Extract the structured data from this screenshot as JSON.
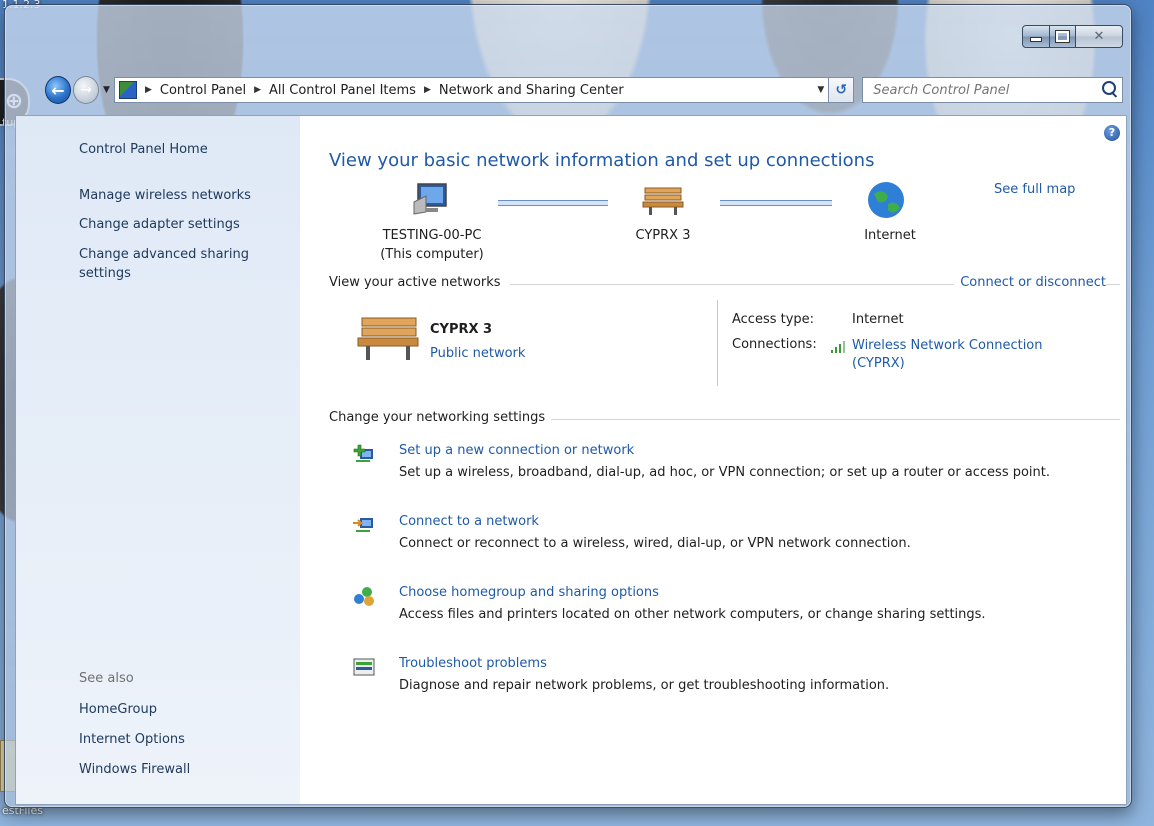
{
  "desktop": {
    "top_left_fragment": "1.1.2.3",
    "left_fragment": "tup",
    "bottom_left_fragment": "estFiles"
  },
  "window": {
    "caption": {
      "minimize": "",
      "maximize": "",
      "close": "✕"
    }
  },
  "navbar": {
    "breadcrumbs": [
      "Control Panel",
      "All Control Panel Items",
      "Network and Sharing Center"
    ],
    "search_placeholder": "Search Control Panel"
  },
  "sidebar": {
    "home": "Control Panel Home",
    "links": [
      "Manage wireless networks",
      "Change adapter settings",
      "Change advanced sharing settings"
    ],
    "see_also_label": "See also",
    "see_also_links": [
      "HomeGroup",
      "Internet Options",
      "Windows Firewall"
    ]
  },
  "main": {
    "title": "View your basic network information and set up connections",
    "see_full_map": "See full map",
    "map": {
      "computer_name": "TESTING-00-PC",
      "computer_sub": "(This computer)",
      "network_name": "CYPRX  3",
      "internet": "Internet"
    },
    "active_networks": {
      "title": "View your active networks",
      "connect_link": "Connect or disconnect",
      "network_name": "CYPRX  3",
      "network_type": "Public network",
      "access_type_label": "Access type:",
      "access_type_value": "Internet",
      "connections_label": "Connections:",
      "connection_name_1": "Wireless Network Connection",
      "connection_name_2": "(CYPRX)"
    },
    "change_settings": {
      "title": "Change your networking settings",
      "tasks": [
        {
          "link": "Set up a new connection or network",
          "desc": "Set up a wireless, broadband, dial-up, ad hoc, or VPN connection; or set up a router or access point."
        },
        {
          "link": "Connect to a network",
          "desc": "Connect or reconnect to a wireless, wired, dial-up, or VPN network connection."
        },
        {
          "link": "Choose homegroup and sharing options",
          "desc": "Access files and printers located on other network computers, or change sharing settings."
        },
        {
          "link": "Troubleshoot problems",
          "desc": "Diagnose and repair network problems, or get troubleshooting information."
        }
      ]
    }
  },
  "colors": {
    "link": "#1e5aa8",
    "sidebar_bg": "#dfe9f6",
    "title_blue": "#1e5aa8"
  }
}
